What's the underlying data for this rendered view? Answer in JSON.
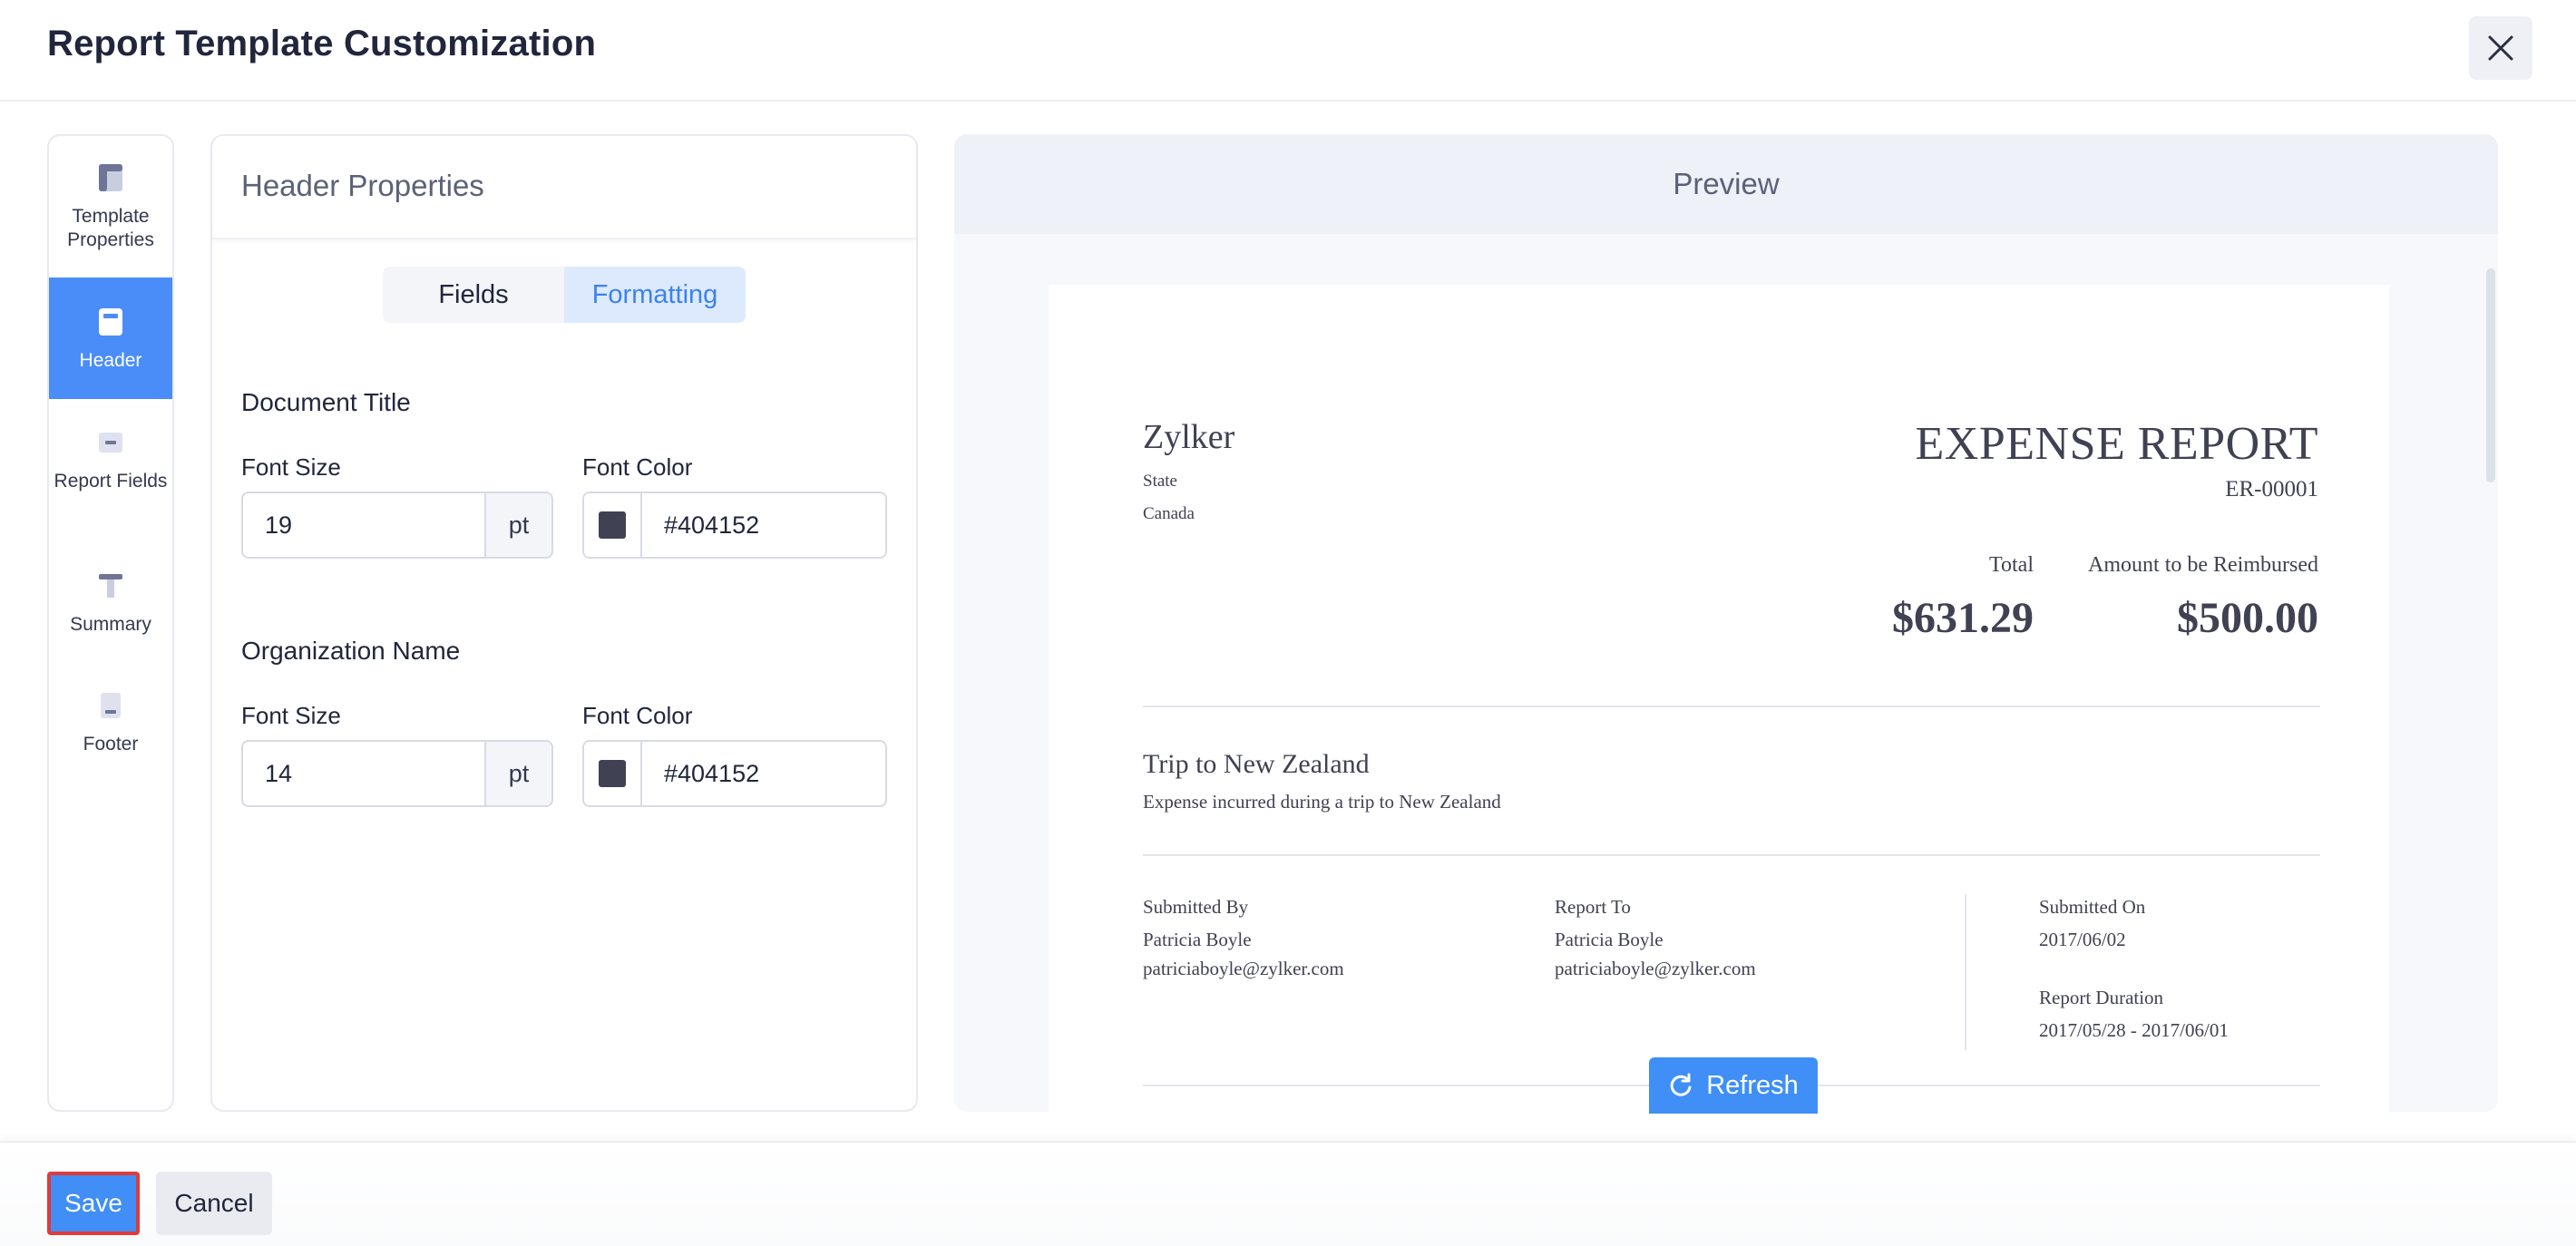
{
  "dialog": {
    "title": "Report Template Customization",
    "close_icon": "close-icon"
  },
  "side_nav": {
    "items": [
      {
        "label": "Template Properties",
        "icon": "template-properties-icon",
        "active": false
      },
      {
        "label": "Header",
        "icon": "header-icon",
        "active": true
      },
      {
        "label": "Report Fields",
        "icon": "report-fields-icon",
        "active": false
      },
      {
        "label": "Summary",
        "icon": "summary-icon",
        "active": false
      },
      {
        "label": "Footer",
        "icon": "footer-icon",
        "active": false
      }
    ]
  },
  "props": {
    "title": "Header Properties",
    "tabs": [
      {
        "label": "Fields",
        "active": false
      },
      {
        "label": "Formatting",
        "active": true
      }
    ],
    "document_title": {
      "section": "Document Title",
      "font_size_label": "Font Size",
      "font_size": "19",
      "unit": "pt",
      "font_color_label": "Font Color",
      "font_color": "#404152"
    },
    "organization_name": {
      "section": "Organization Name",
      "font_size_label": "Font Size",
      "font_size": "14",
      "unit": "pt",
      "font_color_label": "Font Color",
      "font_color": "#404152"
    }
  },
  "preview": {
    "title": "Preview",
    "doc": {
      "org_name": "Zylker",
      "address_line1": "State",
      "address_line2": "Canada",
      "doc_title": "EXPENSE REPORT",
      "doc_number": "ER-00001",
      "total_label": "Total",
      "total_value": "$631.29",
      "reimburse_label": "Amount to be Reimbursed",
      "reimburse_value": "$500.00",
      "trip_title": "Trip to New Zealand",
      "trip_desc": "Expense incurred during a trip to New Zealand",
      "submitted_by_label": "Submitted By",
      "submitted_by_name": "Patricia Boyle",
      "submitted_by_email": "patriciaboyle@zylker.com",
      "report_to_label": "Report To",
      "report_to_name": "Patricia Boyle",
      "report_to_email": "patriciaboyle@zylker.com",
      "submitted_on_label": "Submitted On",
      "submitted_on_value": "2017/06/02",
      "duration_label": "Report Duration",
      "duration_value": "2017/05/28 - 2017/06/01"
    },
    "refresh_label": "Refresh",
    "refresh_icon": "refresh-icon"
  },
  "footer": {
    "save_label": "Save",
    "cancel_label": "Cancel"
  },
  "colors": {
    "accent": "#4a8df8",
    "text": "#21263c",
    "swatch": "#404152",
    "highlight": "#e03a3a"
  }
}
